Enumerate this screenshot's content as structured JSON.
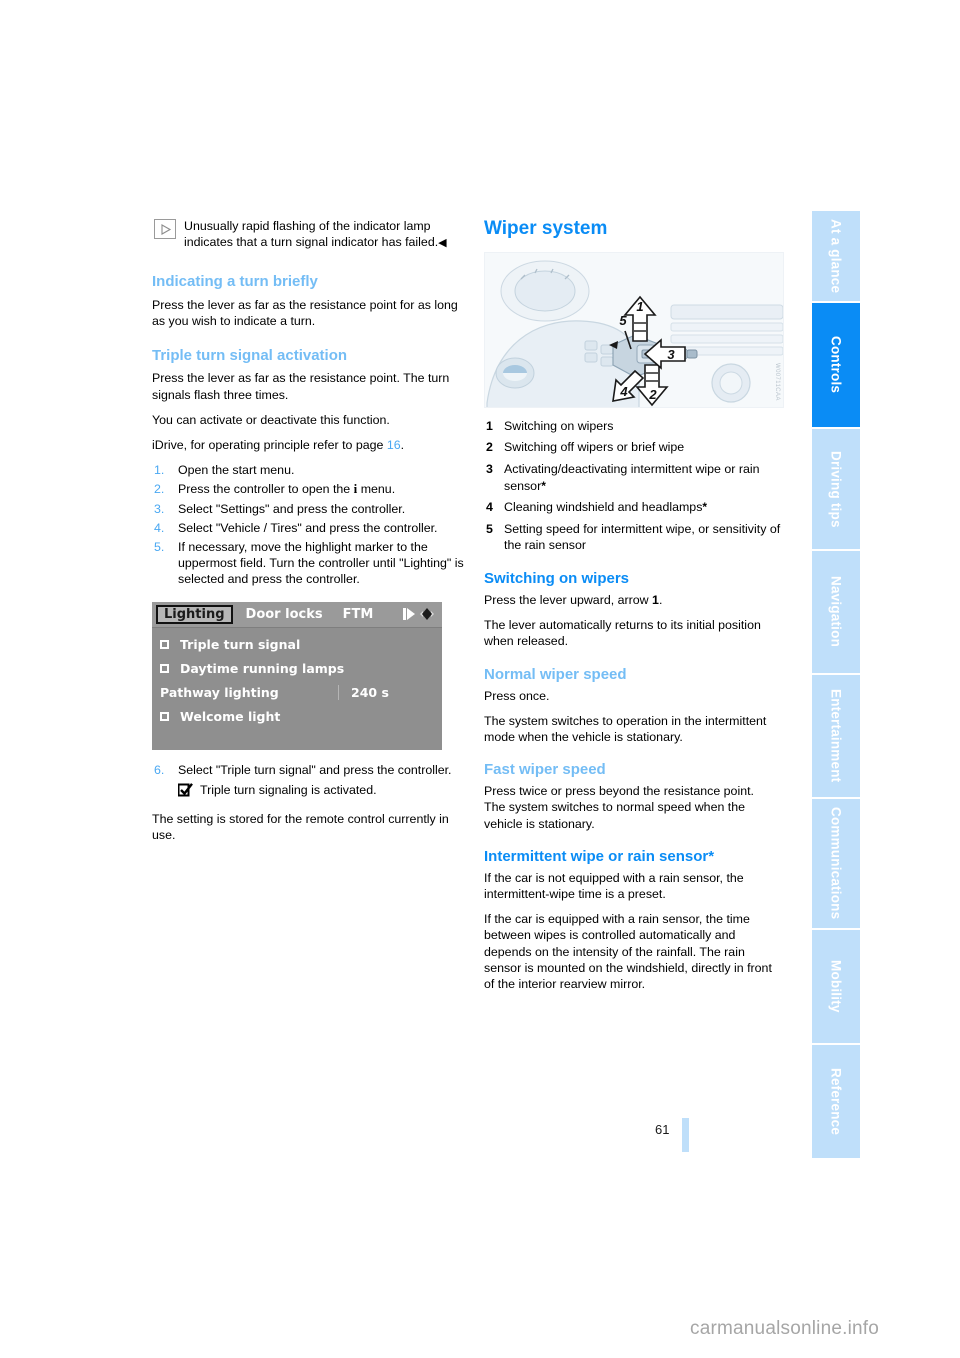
{
  "page": {
    "number": "61",
    "watermark": "carmanualsonline.info"
  },
  "sidebar": {
    "tabs": [
      {
        "label": "At a glance",
        "active": false
      },
      {
        "label": "Controls",
        "active": true
      },
      {
        "label": "Driving tips",
        "active": false
      },
      {
        "label": "Navigation",
        "active": false
      },
      {
        "label": "Entertainment",
        "active": false
      },
      {
        "label": "Communications",
        "active": false
      },
      {
        "label": "Mobility",
        "active": false
      },
      {
        "label": "Reference",
        "active": false
      }
    ]
  },
  "colors": {
    "accent_blue": "#0a8cf5",
    "light_blue": "#74bdf5",
    "tab_inactive": "#bfdffa",
    "xref_blue": "#4aa8f2"
  },
  "left_column": {
    "note": {
      "icon": "triangle-outline-icon",
      "text": "Unusually rapid flashing of the indicator lamp indicates that a turn signal indicator has failed.",
      "endmark": "◀"
    },
    "section_indicating": {
      "heading": "Indicating a turn briefly",
      "body": "Press the lever as far as the resistance point for as long as you wish to indicate a turn."
    },
    "section_triple": {
      "heading": "Triple turn signal activation",
      "p1": "Press the lever as far as the resistance point. The turn signals flash three times.",
      "p2": "You can activate or deactivate this function.",
      "p3_prefix": "iDrive, for operating principle refer to page ",
      "p3_page": "16",
      "p3_suffix": ".",
      "steps": [
        {
          "num": "1.",
          "text": "Open the start menu."
        },
        {
          "num": "2.",
          "text_before": "Press the controller to open the ",
          "glyph": "i",
          "text_after": " menu."
        },
        {
          "num": "3.",
          "text": "Select \"Settings\" and press the controller."
        },
        {
          "num": "4.",
          "text": "Select \"Vehicle / Tires\" and press the controller."
        },
        {
          "num": "5.",
          "text": "If necessary, move the highlight marker to the uppermost field. Turn the controller until \"Lighting\" is selected and press the controller."
        }
      ],
      "step6": {
        "num": "6.",
        "text": "Select \"Triple turn signal\" and press the controller."
      },
      "result": {
        "icon": "checked-checkbox-icon",
        "text": "Triple turn signaling is activated."
      },
      "closing": "The setting is stored for the remote control currently in use."
    },
    "idrive_screenshot": {
      "alt_name": "idrive-lighting-menu",
      "tabs": [
        {
          "label": "Lighting",
          "selected": true
        },
        {
          "label": "Door locks",
          "selected": false
        },
        {
          "label": "FTM",
          "selected": false
        }
      ],
      "nav_icons": [
        "next-arrow-icon",
        "controller-knob-icon"
      ],
      "rows": [
        {
          "checkbox": true,
          "label": "Triple turn signal",
          "value": ""
        },
        {
          "checkbox": true,
          "label": "Daytime running lamps",
          "value": ""
        },
        {
          "checkbox": false,
          "label": "Pathway lighting",
          "value": "240 s"
        },
        {
          "checkbox": true,
          "label": "Welcome light",
          "value": ""
        }
      ]
    }
  },
  "right_column": {
    "title": "Wiper system",
    "figure": {
      "alt_name": "wiper-stalk-illustration",
      "callouts": [
        "1",
        "2",
        "3",
        "4",
        "5"
      ]
    },
    "legend": [
      {
        "num": "1",
        "text": "Switching on wipers",
        "star": false
      },
      {
        "num": "2",
        "text": "Switching off wipers or brief wipe",
        "star": false
      },
      {
        "num": "3",
        "text": "Activating/deactivating intermittent wipe or rain sensor",
        "star": true
      },
      {
        "num": "4",
        "text": "Cleaning windshield and headlamps",
        "star": true
      },
      {
        "num": "5",
        "text": "Setting speed for intermittent wipe, or sensitivity of the rain sensor",
        "star": false
      }
    ],
    "section_switching": {
      "heading": "Switching on wipers",
      "p1_before": "Press the lever upward, arrow ",
      "p1_bold": "1",
      "p1_after": ".",
      "p2": "The lever automatically returns to its initial position when released."
    },
    "section_normal": {
      "heading": "Normal wiper speed",
      "p1": "Press once.",
      "p2": "The system switches to operation in the intermittent mode when the vehicle is stationary."
    },
    "section_fast": {
      "heading": "Fast wiper speed",
      "p1": "Press twice or press beyond the resistance point.",
      "p2": "The system switches to normal speed when the vehicle is stationary."
    },
    "section_intermittent": {
      "heading": "Intermittent wipe or rain sensor*",
      "p1": "If the car is not equipped with a rain sensor, the intermittent-wipe time is a preset.",
      "p2": "If the car is equipped with a rain sensor, the time between wipes is controlled automatically and depends on the intensity of the rainfall. The rain sensor is mounted on the windshield, directly in front of the interior rearview mirror."
    }
  }
}
